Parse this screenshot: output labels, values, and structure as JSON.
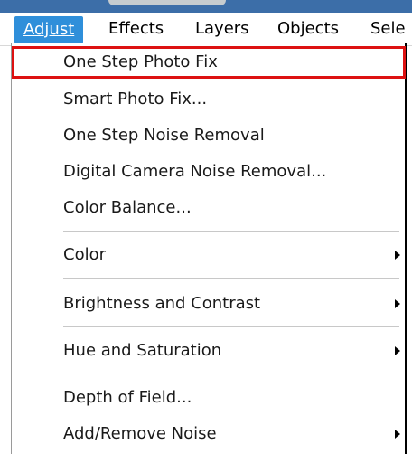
{
  "menubar": {
    "items": [
      {
        "label": "Adjust",
        "underline_index": 0,
        "active": true
      },
      {
        "label": "Effects",
        "underline_index": 5
      },
      {
        "label": "Layers",
        "underline_index": 0
      },
      {
        "label": "Objects",
        "underline_index": 0
      },
      {
        "label": "Sele",
        "underline_index": -1
      }
    ]
  },
  "dropdown": {
    "items": [
      {
        "label": "One Step Photo Fix",
        "underline": "O",
        "highlighted": true,
        "submenu": false
      },
      {
        "label": "Smart Photo Fix...",
        "underline": "a",
        "submenu": false
      },
      {
        "label": "One Step Noise Removal",
        "underline": "n",
        "submenu": false
      },
      {
        "label": "Digital Camera Noise Removal...",
        "underline": "C",
        "submenu": false
      },
      {
        "label": "Color Balance...",
        "underline": "e",
        "submenu": false
      },
      {
        "label": "Color",
        "underline": "o",
        "submenu": true
      },
      {
        "label": "Brightness and Contrast",
        "underline": "",
        "submenu": true
      },
      {
        "label": "Hue and Saturation",
        "underline": "u",
        "submenu": true
      },
      {
        "label": "Depth of Field...",
        "underline": "",
        "submenu": false
      },
      {
        "label": "Add/Remove Noise",
        "underline": "v",
        "submenu": true
      }
    ]
  },
  "icons": {
    "submenu_arrow": "chevron-right-icon"
  },
  "colors": {
    "active_menu": "#2f8fda",
    "highlight_border": "#dd1111"
  }
}
